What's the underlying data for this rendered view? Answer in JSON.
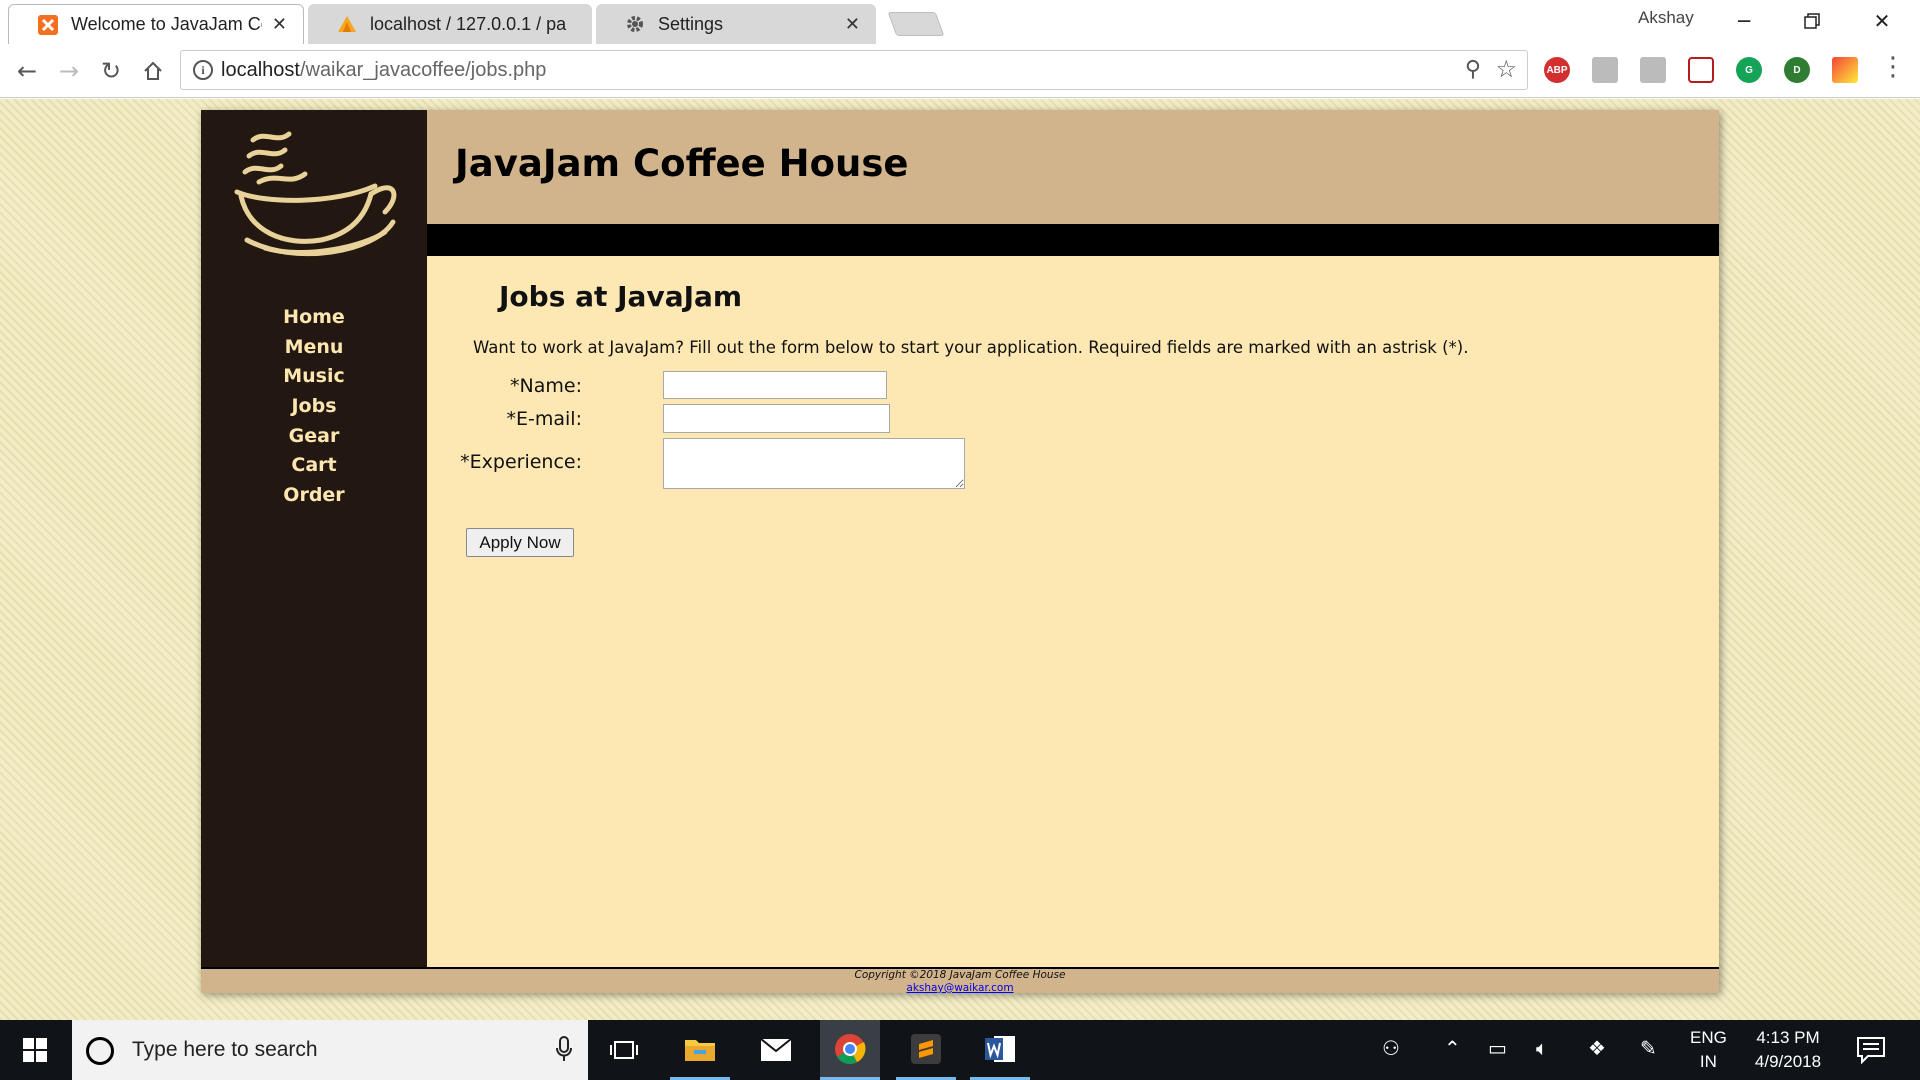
{
  "browser": {
    "tabs": [
      {
        "title": "Welcome to JavaJam Cof",
        "favicon": "xampp-icon",
        "active": true
      },
      {
        "title": "localhost / 127.0.0.1 / pa",
        "favicon": "phpmyadmin-icon",
        "active": false
      },
      {
        "title": "Settings",
        "favicon": "gear-icon",
        "active": false
      }
    ],
    "profile_name": "Akshay",
    "url_host": "localhost",
    "url_path": "/waikar_javacoffee/jobs.php",
    "extensions": [
      "adblock-plus-icon",
      "clipboard-icon",
      "extension-icon",
      "pocket-icon",
      "grammarly-icon",
      "evernote-icon",
      "color-picker-icon"
    ],
    "extension_labels": {
      "adblock": "ABP",
      "grammarly": "G",
      "evernote": "D"
    }
  },
  "site": {
    "title": "JavaJam Coffee House",
    "nav": [
      "Home",
      "Menu",
      "Music",
      "Jobs",
      "Gear",
      "Cart",
      "Order"
    ],
    "heading": "Jobs at JavaJam",
    "intro": "Want to work at JavaJam? Fill out the form below to start your application. Required fields are marked with an astrisk (*).",
    "form": {
      "name_label": "*Name:",
      "name_value": "",
      "email_label": "*E-mail:",
      "email_value": "",
      "experience_label": "*Experience:",
      "experience_value": "",
      "submit_label": "Apply Now"
    },
    "footer": {
      "copyright": "Copyright ©2018 JavaJam Coffee House",
      "email": "akshay@waikar.com"
    }
  },
  "taskbar": {
    "search_placeholder": "Type here to search",
    "lang_line1": "ENG",
    "lang_line2": "IN",
    "time": "4:13 PM",
    "date": "4/9/2018"
  }
}
